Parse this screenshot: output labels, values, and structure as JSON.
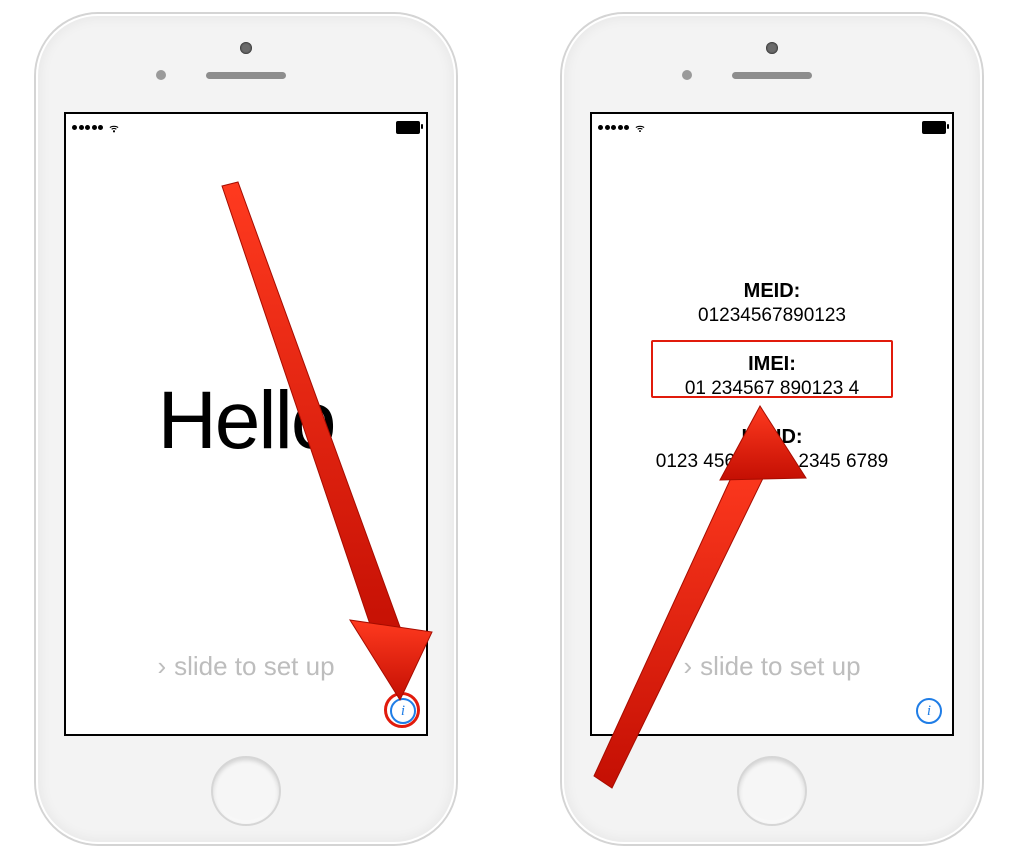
{
  "left_phone": {
    "hello": "Hello",
    "slide_text": "slide to set up",
    "info_glyph": "i"
  },
  "right_phone": {
    "slide_text": "slide to set up",
    "info_glyph": "i",
    "meid": {
      "label": "MEID:",
      "value": "01234567890123"
    },
    "imei": {
      "label": "IMEI:",
      "value": "01 234567 890123 4"
    },
    "iccid": {
      "label": "ICCID:",
      "value": "0123 4567 8901 2345 6789"
    }
  },
  "colors": {
    "accent_blue": "#1f7de6",
    "highlight_red": "#e11b0c"
  }
}
